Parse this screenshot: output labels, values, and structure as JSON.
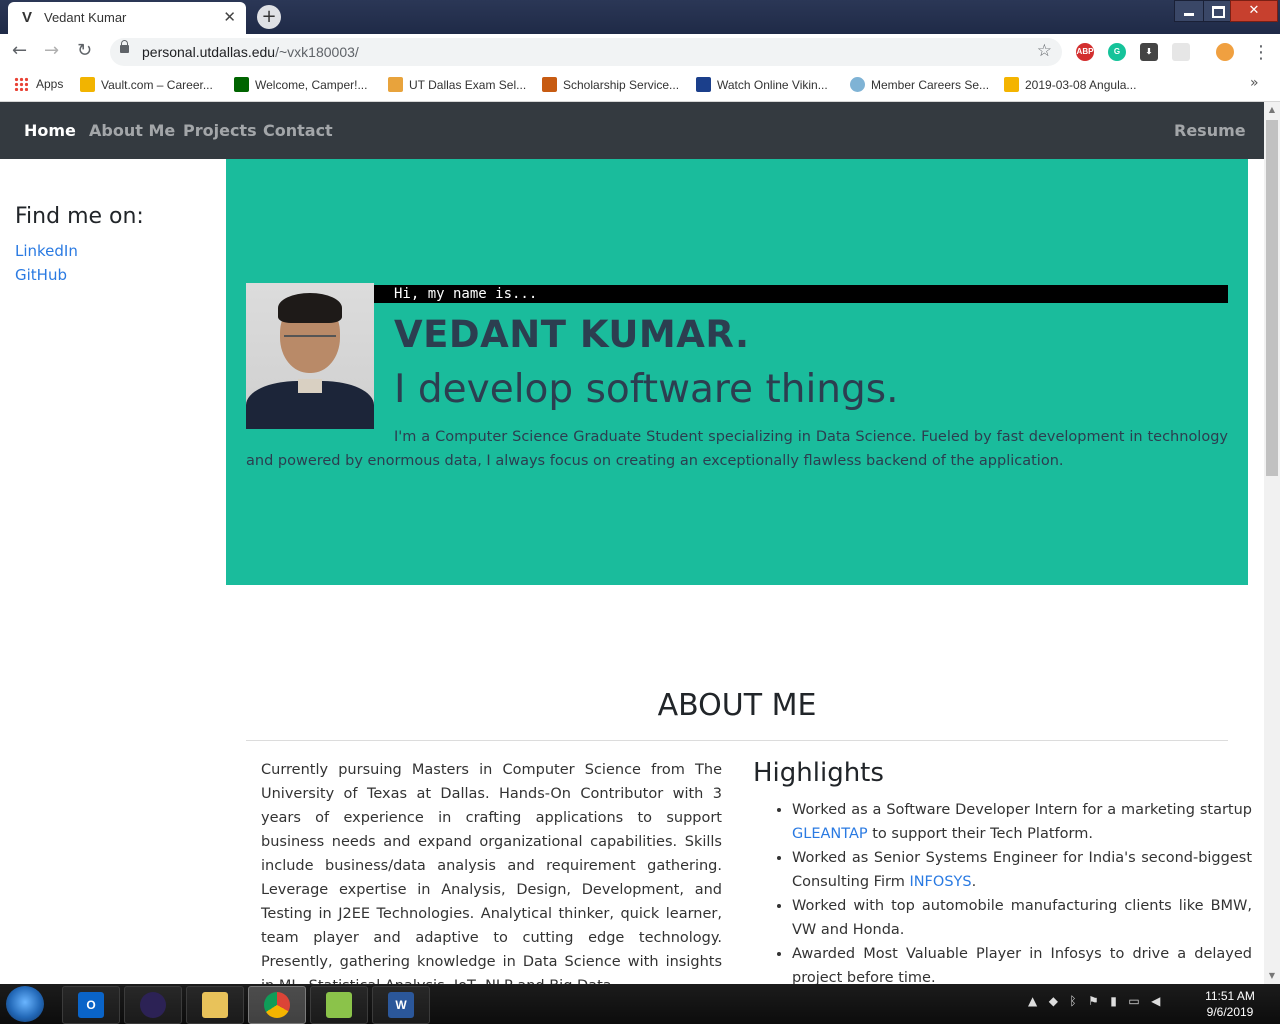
{
  "browser": {
    "tab_favicon": "V",
    "tab_title": "Vedant Kumar",
    "new_tab": "+",
    "url_host": "personal.utdallas.edu",
    "url_path": "/~vxk180003/",
    "bookmarks": [
      {
        "label": "Apps",
        "icon": "apps-grid-icon",
        "color": "#e94235"
      },
      {
        "label": "Vault.com – Career...",
        "icon": "vault-icon",
        "color": "#f2b400"
      },
      {
        "label": "Welcome, Camper!...",
        "icon": "freecodecamp-icon",
        "color": "#006400"
      },
      {
        "label": "UT Dallas Exam Sel...",
        "icon": "utd-exam-icon",
        "color": "#e8a33c"
      },
      {
        "label": "Scholarship Service...",
        "icon": "utd-scholarship-icon",
        "color": "#c75b12"
      },
      {
        "label": "Watch Online Vikin...",
        "icon": "vikings-icon",
        "color": "#1b3f8b"
      },
      {
        "label": "Member Careers Se...",
        "icon": "member-careers-icon",
        "color": "#7fb3d5"
      },
      {
        "label": "2019-03-08 Angula...",
        "icon": "slides-icon",
        "color": "#f4b400"
      }
    ]
  },
  "nav": {
    "home": "Home",
    "about": "About Me",
    "projects": "Projects",
    "contact": "Contact",
    "resume": "Resume"
  },
  "sidebar": {
    "title": "Find me on:",
    "links": [
      "LinkedIn",
      "GitHub"
    ]
  },
  "hero": {
    "greeting": "Hi, my name is...",
    "name": "VEDANT KUMAR.",
    "tagline": "I develop software things.",
    "description": "I'm a Computer Science Graduate Student specializing in Data Science. Fueled by fast development in technology and powered by enormous data, I always focus on creating an exceptionally flawless backend of the application."
  },
  "about": {
    "title": "ABOUT ME",
    "paragraph": "Currently pursuing Masters in Computer Science from The University of Texas at Dallas. Hands-On Contributor with 3 years of experience in crafting applications to support business needs and expand organizational capabilities. Skills include business/data analysis and requirement gathering. Leverage expertise in Analysis, Design, Development, and Testing in J2EE Technologies. Analytical thinker, quick learner, team player and adaptive to cutting edge technology. Presently, gathering knowledge in Data Science with insights in ML, Statistical Analysis, IoT, NLP and Big Data.",
    "highlights_title": "Highlights",
    "highlights": [
      {
        "before": "Worked as a Software Developer Intern for a marketing startup ",
        "link": "GLEANTAP",
        "after": " to support their Tech Platform."
      },
      {
        "before": "Worked as Senior Systems Engineer for India's second-biggest Consulting Firm ",
        "link": "INFOSYS",
        "after": "."
      },
      {
        "before": "Worked with top automobile manufacturing clients like BMW, VW and Honda.",
        "link": "",
        "after": ""
      },
      {
        "before": "Awarded Most Valuable Player in Infosys to drive a delayed project before time.",
        "link": "",
        "after": ""
      }
    ]
  },
  "colors": {
    "navbar": "#343a40",
    "hero": "#1abc9c",
    "hero_text": "#2c3e50",
    "link": "#2a7ae2"
  },
  "taskbar": {
    "apps": [
      {
        "name": "outlook-icon",
        "label": "O",
        "color": "#0a64c8"
      },
      {
        "name": "eclipse-icon",
        "label": "",
        "color": "#2c2255"
      },
      {
        "name": "file-explorer-icon",
        "label": "",
        "color": "#e8c25a"
      },
      {
        "name": "chrome-icon",
        "label": "",
        "color": "#db4437"
      },
      {
        "name": "notepad-plus-plus-icon",
        "label": "",
        "color": "#8bc34a"
      },
      {
        "name": "word-icon",
        "label": "W",
        "color": "#2b579a"
      }
    ],
    "time": "11:51 AM",
    "date": "9/6/2019"
  }
}
